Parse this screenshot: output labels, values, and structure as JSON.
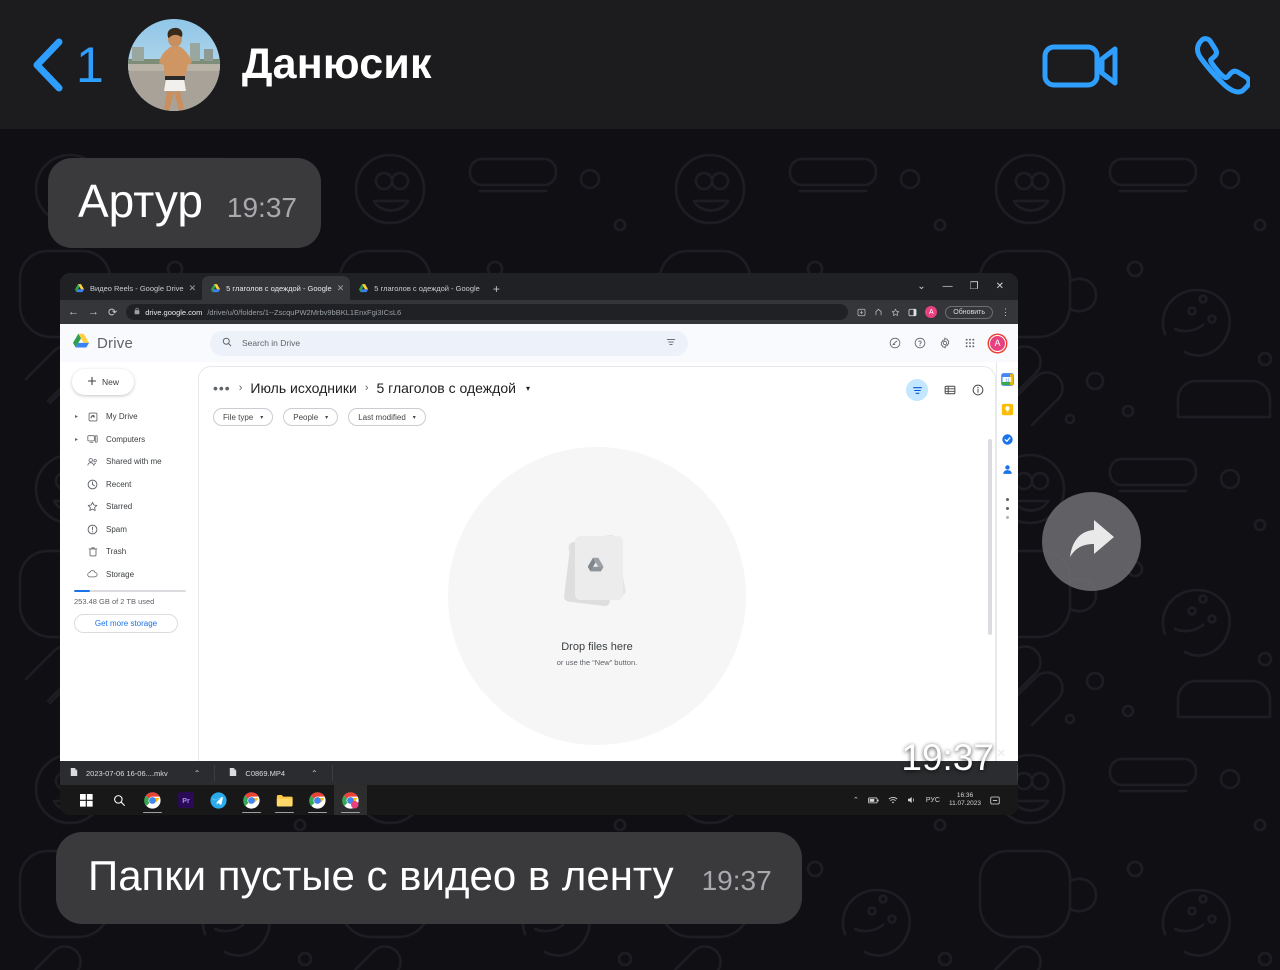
{
  "header": {
    "back_count": "1",
    "peer_name": "Данюсик",
    "back_icon": "chevron-left-icon",
    "video_icon": "video-camera-icon",
    "call_icon": "phone-icon",
    "avatar_alt": "peer-avatar-photo"
  },
  "messages": [
    {
      "text": "Артур",
      "time": "19:37"
    },
    {
      "text": "Папки пустые с видео в ленту",
      "time": "19:37"
    }
  ],
  "photo_message": {
    "time": "19:37",
    "forward_icon": "forward-arrow-icon",
    "close_mark": "×"
  },
  "screenshot": {
    "browser": {
      "tabs": [
        {
          "title": "Видео Reels - Google Drive",
          "active": false,
          "close": "✕"
        },
        {
          "title": "5 глаголов с одеждой - Google",
          "active": true,
          "close": "✕"
        },
        {
          "title": "5 глаголов с одеждой - Google",
          "active": false,
          "close": "✕"
        }
      ],
      "new_tab_label": "+",
      "window_controls": {
        "minimize_list": "⌄",
        "minimize": "—",
        "maximize": "❐",
        "close": "✕"
      },
      "nav": {
        "back": "←",
        "forward": "→",
        "reload": "⟳"
      },
      "url_domain": "drive.google.com",
      "url_path": "/drive/u/0/folders/1--ZscquPW2Mrbv9bBKL1EnxFgi3ICsL6",
      "update_button": "Обновить",
      "avatar_letter": "A",
      "kebab": "⋮"
    },
    "drive": {
      "brand": "Drive",
      "search_placeholder": "Search in Drive",
      "new_button": "New",
      "nav_items": [
        {
          "label": "My Drive",
          "icon": "my-drive-icon",
          "expandable": true
        },
        {
          "label": "Computers",
          "icon": "computers-icon",
          "expandable": true
        },
        {
          "label": "Shared with me",
          "icon": "shared-with-me-icon",
          "expandable": false
        },
        {
          "label": "Recent",
          "icon": "recent-clock-icon",
          "expandable": false
        },
        {
          "label": "Starred",
          "icon": "star-icon",
          "expandable": false
        },
        {
          "label": "Spam",
          "icon": "spam-icon",
          "expandable": false
        },
        {
          "label": "Trash",
          "icon": "trash-icon",
          "expandable": false
        },
        {
          "label": "Storage",
          "icon": "cloud-icon",
          "expandable": false
        }
      ],
      "storage_text": "253.48 GB of 2 TB used",
      "storage_button": "Get more storage",
      "breadcrumb": {
        "dots": "•••",
        "sep": "›",
        "parent": "Июль исходники",
        "current": "5 глаголов с одеждой",
        "caret": "▾"
      },
      "filter_chips": [
        {
          "label": "File type",
          "caret": "▾"
        },
        {
          "label": "People",
          "caret": "▾"
        },
        {
          "label": "Last modified",
          "caret": "▾"
        }
      ],
      "empty_state": {
        "title": "Drop files here",
        "subtitle": "or use the “New” button."
      },
      "top_icons": [
        "activity-icon",
        "help-icon",
        "settings-gear-icon",
        "apps-grid-icon"
      ],
      "view_icons": [
        "filter-icon",
        "list-view-icon",
        "info-icon"
      ],
      "side_rail_icons": [
        "google-calendar-icon",
        "google-keep-icon",
        "google-tasks-icon",
        "google-contacts-icon"
      ],
      "pane_arrow": "›"
    },
    "downloads": [
      {
        "name": "2023-07-06 16-06....mkv",
        "caret": "⌃"
      },
      {
        "name": "C0869.MP4",
        "caret": "⌃"
      }
    ],
    "taskbar": {
      "items": [
        {
          "name": "start-button",
          "icon": "windows-logo-icon"
        },
        {
          "name": "search-button",
          "icon": "search-icon"
        },
        {
          "name": "chrome-task",
          "icon": "chrome-icon"
        },
        {
          "name": "premiere-task",
          "icon": "premiere-pro-icon",
          "label": "Pr"
        },
        {
          "name": "telegram-task",
          "icon": "telegram-icon"
        },
        {
          "name": "chrome-task-2",
          "icon": "chrome-icon"
        },
        {
          "name": "explorer-task",
          "icon": "file-explorer-icon"
        },
        {
          "name": "chrome-task-3",
          "icon": "chrome-icon"
        },
        {
          "name": "chrome-task-4",
          "icon": "chrome-icon"
        }
      ],
      "tray": {
        "chevron": "⌃",
        "battery_icon": "battery-icon",
        "wifi_icon": "wifi-icon",
        "volume_icon": "volume-icon",
        "language": "РУС",
        "time": "16:36",
        "date": "11.07.2023",
        "notification_icon": "notification-icon"
      }
    }
  },
  "colors": {
    "accent_blue": "#2f9fff",
    "bubble": "#3a3a3c",
    "header_bg": "#1c1c1e",
    "chat_bg": "#101014",
    "drive_blue": "#1a73e8",
    "avatar_pink": "#e8417f"
  }
}
